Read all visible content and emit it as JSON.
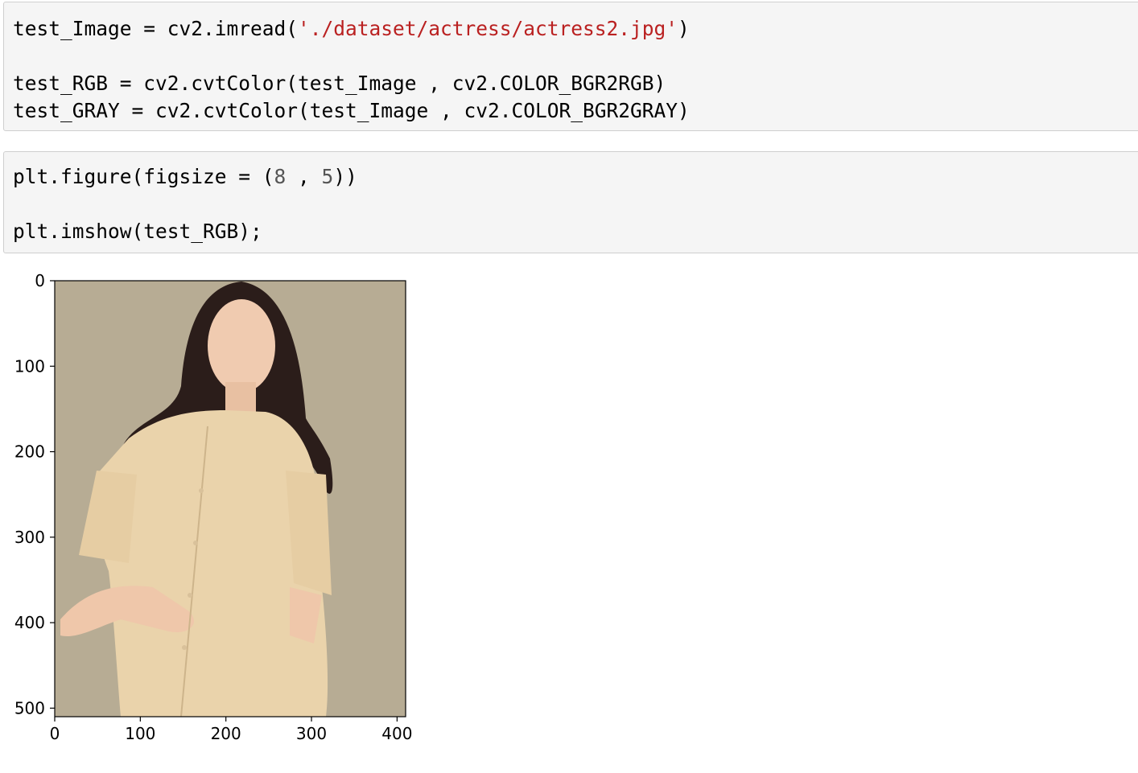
{
  "cells": [
    {
      "lines": [
        {
          "pre": "test_Image = cv2.imread(",
          "str": "'./dataset/actress/actress2.jpg'",
          "post": ")"
        },
        {
          "text": "test_RGB = cv2.cvtColor(test_Image , cv2.COLOR_BGR2RGB)"
        },
        {
          "text": "test_GRAY = cv2.cvtColor(test_Image , cv2.COLOR_BGR2GRAY)"
        }
      ]
    },
    {
      "lines": [
        {
          "pre": "plt.figure(figsize = (",
          "num1": "8",
          "mid": " , ",
          "num2": "5",
          "post": "))"
        },
        {
          "text": "plt.imshow(test_RGB);"
        }
      ]
    }
  ],
  "chart_data": {
    "type": "image",
    "xlim": [
      0,
      410
    ],
    "ylim": [
      510,
      0
    ],
    "x_ticks": [
      "0",
      "100",
      "200",
      "300",
      "400"
    ],
    "y_ticks": [
      "0",
      "100",
      "200",
      "300",
      "400",
      "500"
    ],
    "x_tick_values": [
      0,
      100,
      200,
      300,
      400
    ],
    "y_tick_values": [
      0,
      100,
      200,
      300,
      400,
      500
    ]
  },
  "colors": {
    "background_beige": "#b7ac94",
    "shirt": "#ead3ab",
    "hair": "#2b1d1a",
    "skin": "#f0cbb0",
    "string_literal": "#ba2121"
  }
}
